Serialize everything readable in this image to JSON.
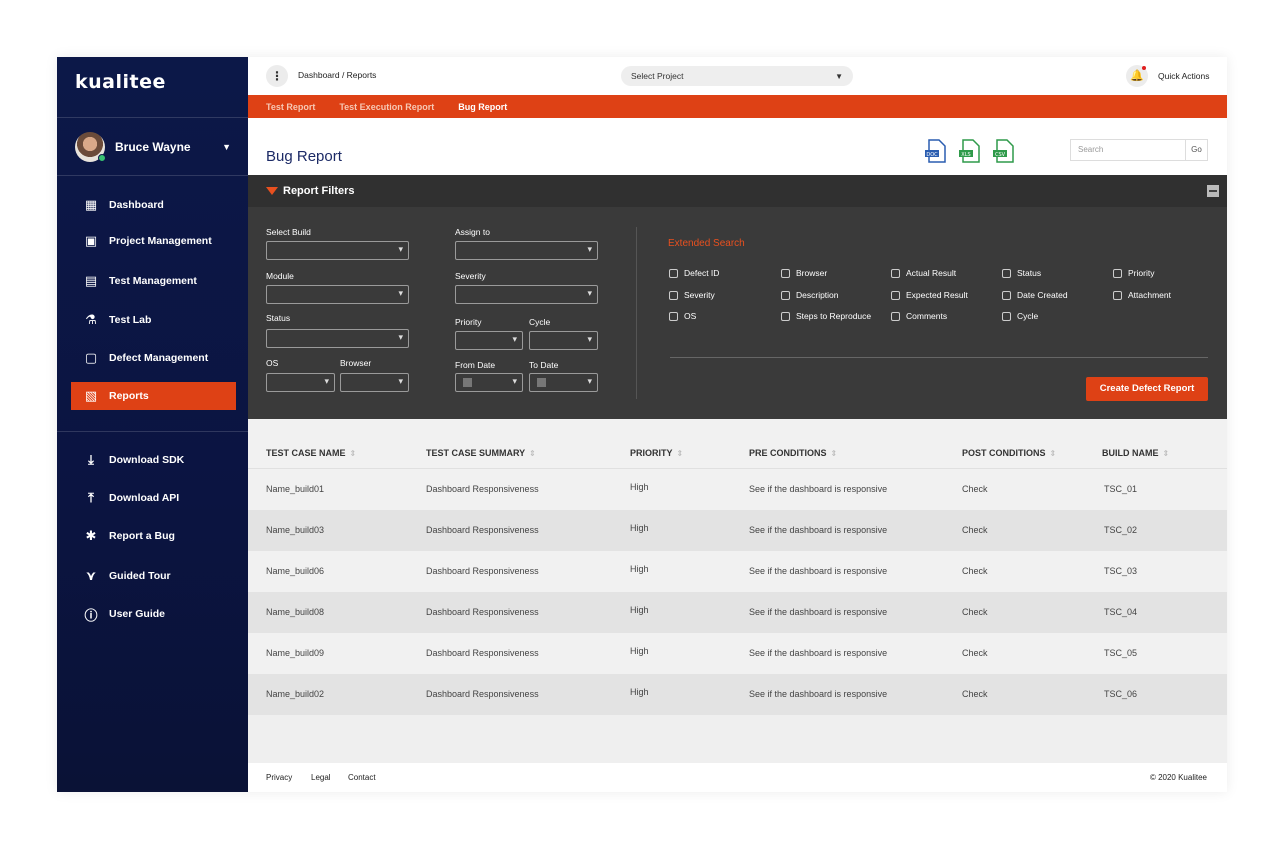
{
  "sidebar": {
    "logo": "kualitee",
    "user_name": "Bruce Wayne",
    "items": [
      {
        "label": "Dashboard",
        "icon": "dashboard-icon"
      },
      {
        "label": "Project Management",
        "icon": "project-icon"
      },
      {
        "label": "Test Management",
        "icon": "test-management-icon"
      },
      {
        "label": "Test Lab",
        "icon": "flask-icon"
      },
      {
        "label": "Defect Management",
        "icon": "defect-icon"
      },
      {
        "label": "Reports",
        "icon": "reports-icon",
        "active": true
      }
    ],
    "secondary": [
      {
        "label": "Download SDK",
        "icon": "download-icon"
      },
      {
        "label": "Download API",
        "icon": "download-api-icon"
      },
      {
        "label": "Report a Bug",
        "icon": "bug-icon"
      },
      {
        "label": "Guided Tour",
        "icon": "tour-icon"
      },
      {
        "label": "User Guide",
        "icon": "info-icon"
      }
    ]
  },
  "topbar": {
    "breadcrumb": "Dashboard / Reports",
    "project_select": "Select Project",
    "quick_actions": "Quick Actions"
  },
  "tabs": [
    "Test Report",
    "Test Execution Report",
    "Bug Report"
  ],
  "active_tab": "Bug Report",
  "page": {
    "title": "Bug Report",
    "export_icons": [
      "doc-export-icon",
      "xls-export-icon",
      "csv-export-icon"
    ],
    "export_labels": [
      "DOC",
      "XLS",
      "CSV"
    ],
    "search_placeholder": "Search",
    "go_label": "Go"
  },
  "filters": {
    "title": "Report Filters",
    "select_build": "Select Build",
    "assign_to": "Assign to",
    "module": "Module",
    "severity": "Severity",
    "status": "Status",
    "priority": "Priority",
    "cycle": "Cycle",
    "os": "OS",
    "browser": "Browser",
    "from_date": "From Date",
    "to_date": "To Date",
    "extended_title": "Extended Search",
    "extended": [
      "Defect ID",
      "Browser",
      "Actual Result",
      "Status",
      "Priority",
      "Severity",
      "Description",
      "Expected Result",
      "Date Created",
      "Attachment",
      "OS",
      "Steps to Reproduce",
      "Comments",
      "Cycle"
    ],
    "create_button": "Create Defect Report"
  },
  "table": {
    "columns": [
      "TEST CASE NAME",
      "TEST CASE SUMMARY",
      "PRIORITY",
      "PRE CONDITIONS",
      "POST CONDITIONS",
      "BUILD NAME"
    ],
    "rows": [
      [
        "Name_build01",
        "Dashboard Responsiveness",
        "High",
        "See if the dashboard is responsive",
        "Check",
        "TSC_01"
      ],
      [
        "Name_build03",
        "Dashboard Responsiveness",
        "High",
        "See if the dashboard is responsive",
        "Check",
        "TSC_02"
      ],
      [
        "Name_build06",
        "Dashboard Responsiveness",
        "High",
        "See if the dashboard is responsive",
        "Check",
        "TSC_03"
      ],
      [
        "Name_build08",
        "Dashboard Responsiveness",
        "High",
        "See if the dashboard is responsive",
        "Check",
        "TSC_04"
      ],
      [
        "Name_build09",
        "Dashboard Responsiveness",
        "High",
        "See if the dashboard is responsive",
        "Check",
        "TSC_05"
      ],
      [
        "Name_build02",
        "Dashboard Responsiveness",
        "High",
        "See if the dashboard is responsive",
        "Check",
        "TSC_06"
      ]
    ]
  },
  "footer": {
    "links": [
      "Privacy",
      "Legal",
      "Contact"
    ],
    "copyright": "© 2020 Kualitee"
  },
  "colors": {
    "accent": "#de4115",
    "sidebar": "#0c1848",
    "filter_bg": "#3a3a3a"
  }
}
